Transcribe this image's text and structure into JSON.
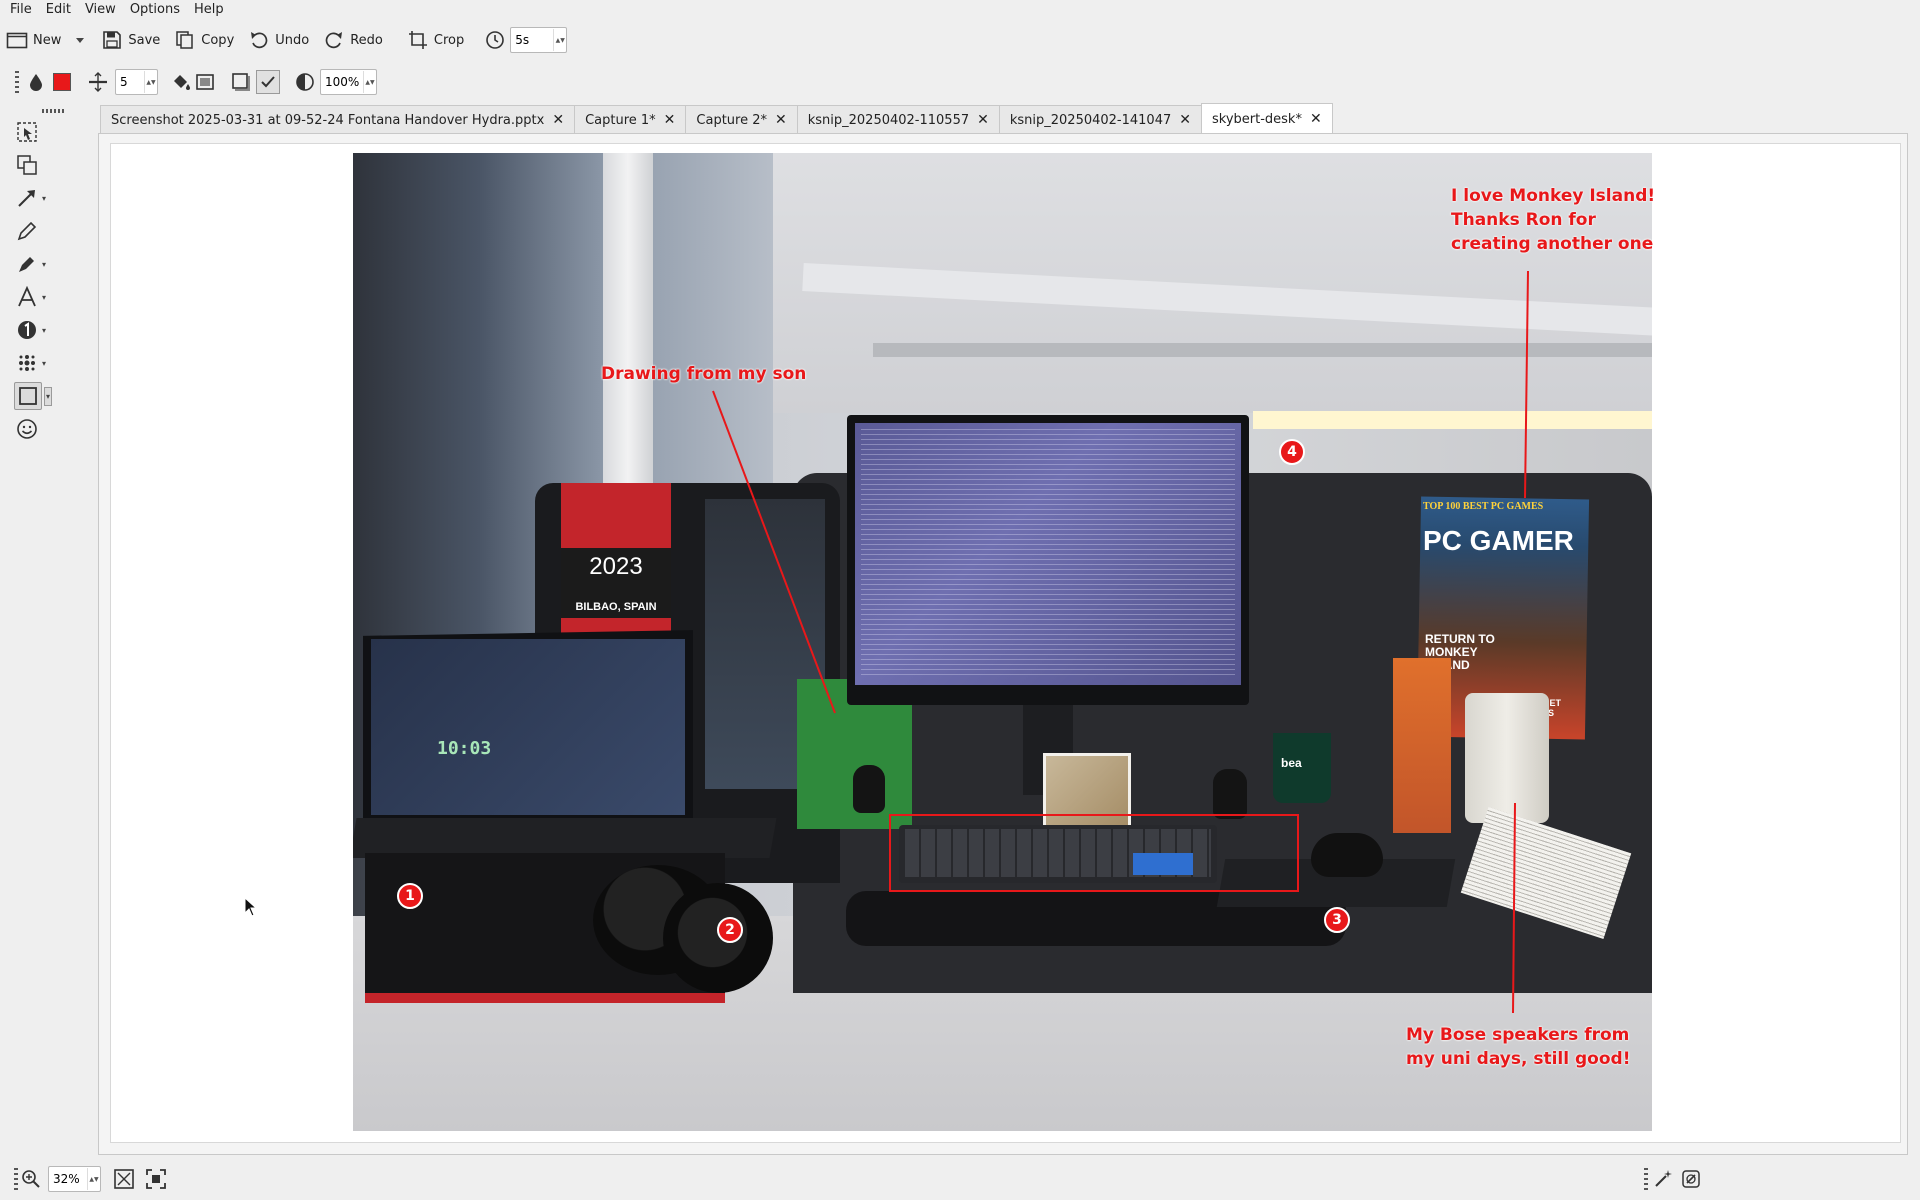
{
  "menubar": {
    "items": [
      "File",
      "Edit",
      "View",
      "Options",
      "Help"
    ],
    "accelerators": [
      "F",
      "E",
      "V",
      "O",
      "H"
    ]
  },
  "toolbar1": {
    "new_label": "New",
    "save_label": "Save",
    "copy_label": "Copy",
    "undo_label": "Undo",
    "redo_label": "Redo",
    "crop_label": "Crop",
    "delay_value": "5s"
  },
  "toolbar2": {
    "width_value": "5",
    "opacity_value": "100%",
    "color": "#e8181a"
  },
  "tabs": [
    {
      "label": "Screenshot 2025-03-31 at 09-52-24 Fontana Handover Hydra.pptx"
    },
    {
      "label": "Capture 1*"
    },
    {
      "label": "Capture 2*"
    },
    {
      "label": "ksnip_20250402-110557"
    },
    {
      "label": "ksnip_20250402-141047"
    },
    {
      "label": "skybert-desk*"
    }
  ],
  "annotations": {
    "son_drawing": "Drawing from my son",
    "monkey_island_line1": "I love Monkey Island!",
    "monkey_island_line2": "Thanks Ron for",
    "monkey_island_line3": "creating another one",
    "bose_line1": "My Bose speakers from",
    "bose_line2": "my uni days, still good!",
    "badges": [
      "1",
      "2",
      "3",
      "4"
    ],
    "color": "#e8181a"
  },
  "photo_text": {
    "scarf_year": "2023",
    "scarf_city": "BILBAO, SPAIN",
    "laptop_clock": "10:03",
    "mag_top": "TOP 100 BEST PC GAMES",
    "mag_title": "PC GAMER",
    "mag_cover": "RETURN TO MONKEY ISLAND",
    "mag_side": "BUDGET CASES",
    "mug": "bea"
  },
  "statusbar": {
    "zoom_value": "32%"
  }
}
